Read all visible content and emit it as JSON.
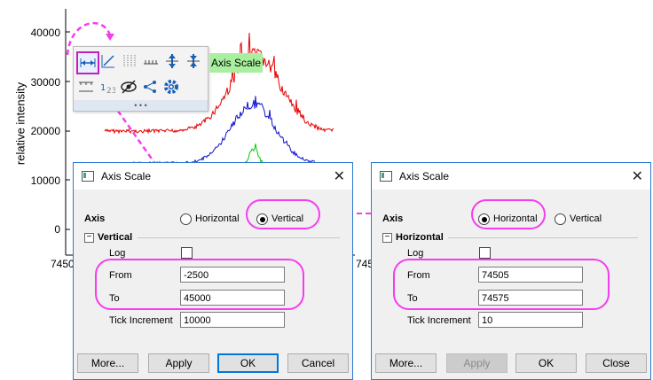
{
  "chart_data": {
    "type": "line",
    "ylabel": "relative intensity",
    "yticks": [
      "40000",
      "30000",
      "20000",
      "10000",
      "0"
    ],
    "xtick_fragments": [
      "7450",
      "745"
    ],
    "colors": {
      "red": "#e60000",
      "blue": "#1010d0",
      "green": "#00cc00"
    }
  },
  "toolbar": {
    "tooltip": "Axis Scale",
    "icons": [
      "axis-scale-icon",
      "diagonal-axis-icon",
      "grid-icon",
      "ticks-icon",
      "rescale-vertical-icon",
      "rescale-horizontal-icon",
      "tick-marks-icon",
      "count-icon",
      "hide-icon",
      "share-icon",
      "settings-icon"
    ],
    "more": "• • •"
  },
  "dialog_left": {
    "title": "Axis Scale",
    "axis_label": "Axis",
    "radio_h": "Horizontal",
    "radio_v": "Vertical",
    "selected": "Vertical",
    "section": "Vertical",
    "log_label": "Log",
    "from_label": "From",
    "from_value": "-2500",
    "to_label": "To",
    "to_value": "45000",
    "tick_label": "Tick Increment",
    "tick_value": "10000",
    "buttons": {
      "more": "More...",
      "apply": "Apply",
      "ok": "OK",
      "cancel": "Cancel"
    }
  },
  "dialog_right": {
    "title": "Axis Scale",
    "axis_label": "Axis",
    "radio_h": "Horizontal",
    "radio_v": "Vertical",
    "selected": "Horizontal",
    "section": "Horizontal",
    "log_label": "Log",
    "from_label": "From",
    "from_value": "74505",
    "to_label": "To",
    "to_value": "74575",
    "tick_label": "Tick Increment",
    "tick_value": "10",
    "buttons": {
      "more": "More...",
      "apply": "Apply",
      "ok": "OK",
      "close": "Close"
    }
  },
  "annotation_color": "#f53cf0"
}
